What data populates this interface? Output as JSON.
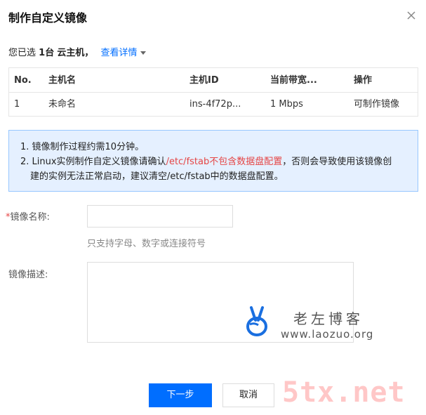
{
  "dialog": {
    "title": "制作自定义镜像",
    "close_label": "×"
  },
  "selection": {
    "prefix": "您已选",
    "count": "1台",
    "item": "云主机，",
    "detail_link": "查看详情"
  },
  "table": {
    "headers": [
      "No.",
      "主机名",
      "主机ID",
      "当前带宽...",
      "操作"
    ],
    "rows": [
      [
        "1",
        "未命名",
        "ins-4f72p...",
        "1 Mbps",
        "可制作镜像"
      ]
    ]
  },
  "tips": {
    "line1": "1. 镜像制作过程约需10分钟。",
    "line2_prefix": "2. Linux实例制作自定义镜像请确认",
    "line2_highlight": "/etc/fstab不包含数据盘配置",
    "line2_suffix": "，否则会导致使用该镜像创",
    "line3": "建的实例无法正常启动，建议清空/etc/fstab中的数据盘配置。"
  },
  "form": {
    "name_required_mark": "*",
    "name_label": "镜像名称:",
    "name_value": "",
    "name_hint": "只支持字母、数字或连接符号",
    "desc_label": "镜像描述:",
    "desc_value": ""
  },
  "watermark": {
    "title": "老左博客",
    "url": "www.laozuo.org",
    "brand": "5tx.net"
  },
  "buttons": {
    "next": "下一步",
    "cancel": "取消"
  },
  "colors": {
    "primary": "#006eff",
    "danger": "#e54545",
    "tip_bg": "#e5f0ff",
    "tip_border": "#97c7ff"
  }
}
